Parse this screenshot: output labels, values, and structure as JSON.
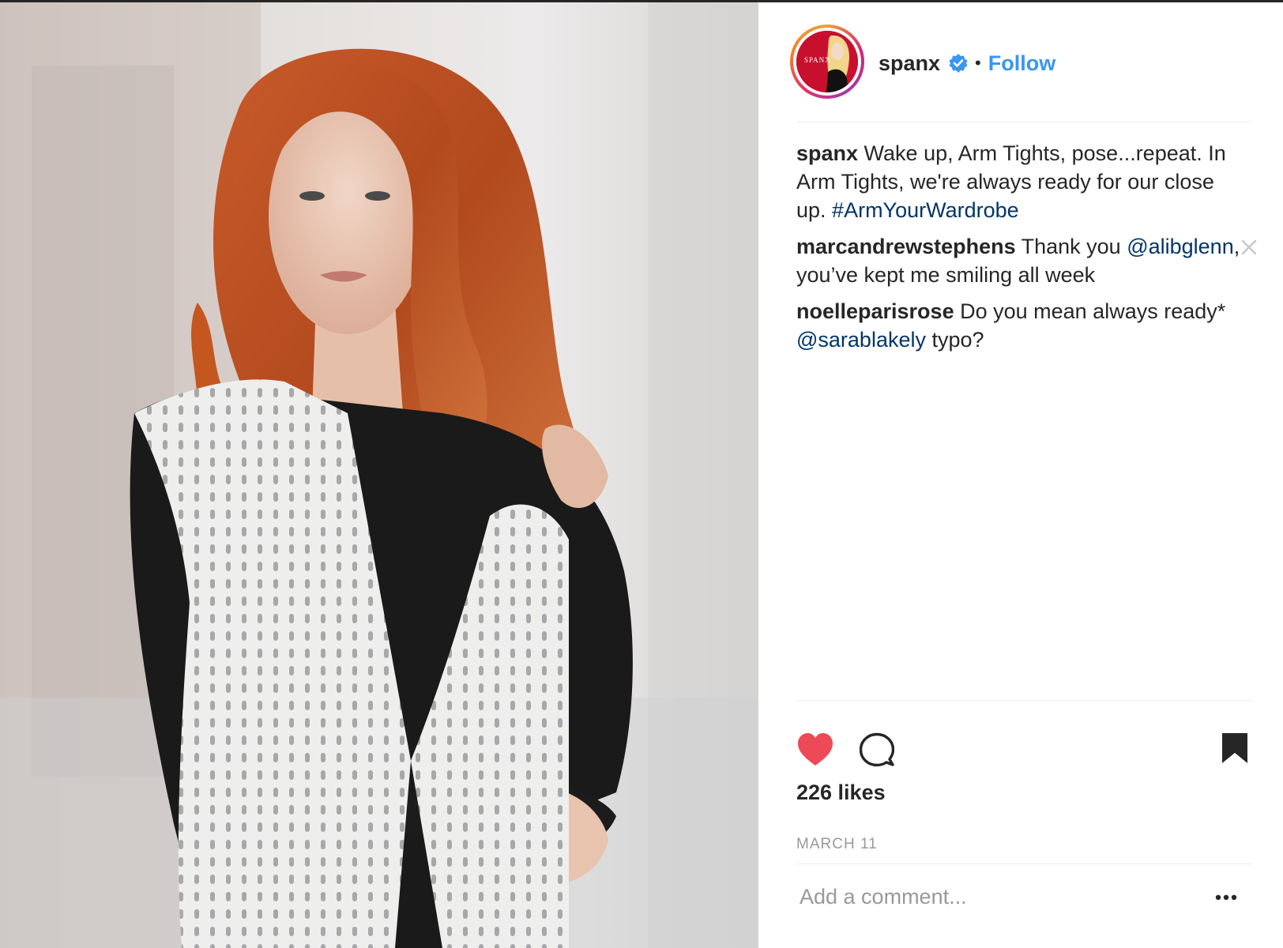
{
  "post": {
    "image_alt": "Woman with long curly red hair wearing a black long-sleeve top and a white textured vest"
  },
  "header": {
    "avatar_brand": "SPANX",
    "username": "spanx",
    "verified_icon": "verified-badge-icon",
    "separator": "•",
    "follow_label": "Follow"
  },
  "comments": [
    {
      "author": "spanx",
      "text": " Wake up, Arm Tights, pose...repeat. In Arm Tights, we're always ready for our close up. ",
      "hashtag": "#ArmYourWardrobe"
    },
    {
      "author": "marcandrewstephens",
      "text_before": " Thank you ",
      "mention": "@alibglenn",
      "text_after": ", you’ve kept me smiling all week"
    },
    {
      "author": "noelleparisrose",
      "text_before": " Do you mean always ready* ",
      "mention": "@sarablakely",
      "text_after": " typo?"
    }
  ],
  "actions": {
    "like_icon": "heart-icon",
    "like_color": "#ed4956",
    "comment_icon": "comment-icon",
    "save_icon": "bookmark-icon"
  },
  "likes_text": "226 likes",
  "date_text": "MARCH 11",
  "comment_input": {
    "placeholder": "Add a comment...",
    "value": ""
  },
  "more_icon": "more-options-icon",
  "colors": {
    "link": "#3897f0",
    "mention": "#003569",
    "muted": "#999999",
    "text": "#262626"
  }
}
